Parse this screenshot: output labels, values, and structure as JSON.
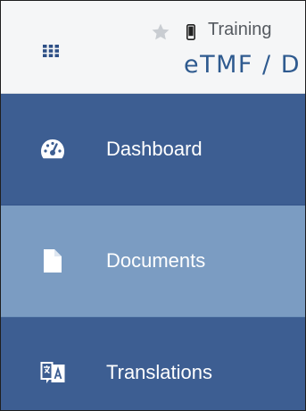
{
  "header": {
    "context_label": "Training",
    "breadcrumb": "eTMF / D",
    "icons": {
      "app_grid": "grid-icon",
      "favorite": "star-icon",
      "device": "mobile-device-icon"
    }
  },
  "menu": {
    "items": [
      {
        "label": "Dashboard",
        "icon": "speedometer-icon",
        "active": false
      },
      {
        "label": "Documents",
        "icon": "document-icon",
        "active": true
      },
      {
        "label": "Translations",
        "icon": "translate-icon",
        "active": false
      }
    ]
  },
  "colors": {
    "header_bg": "#f5f6f7",
    "menu_bg": "#3d5e92",
    "menu_active_bg": "#7b9cc2",
    "breadcrumb_text": "#2e5a8f",
    "menu_text": "#ffffff"
  }
}
